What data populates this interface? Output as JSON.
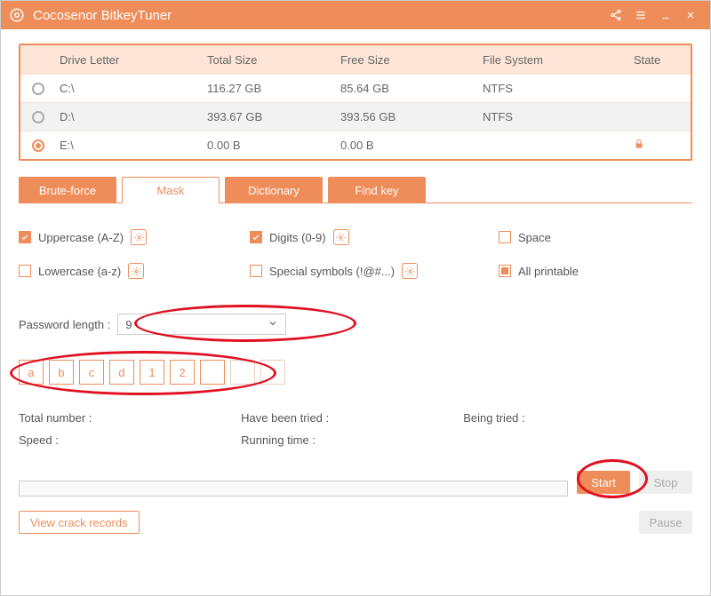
{
  "app": {
    "title": "Cocosenor BitkeyTuner"
  },
  "drives": {
    "headers": {
      "drive": "Drive Letter",
      "total": "Total Size",
      "free": "Free Size",
      "fs": "File System",
      "state": "State"
    },
    "rows": [
      {
        "drive": "C:\\",
        "total": "116.27 GB",
        "free": "85.64 GB",
        "fs": "NTFS",
        "selected": false,
        "locked": false
      },
      {
        "drive": "D:\\",
        "total": "393.67 GB",
        "free": "393.56 GB",
        "fs": "NTFS",
        "selected": false,
        "locked": false
      },
      {
        "drive": "E:\\",
        "total": "0.00 B",
        "free": "0.00 B",
        "fs": "",
        "selected": true,
        "locked": true
      }
    ]
  },
  "tabs": {
    "brute": "Brute-force",
    "mask": "Mask",
    "dict": "Dictionary",
    "findkey": "Find key",
    "active": "mask"
  },
  "options": {
    "uppercase": {
      "label": "Uppercase (A-Z)",
      "checked": true,
      "gear": true
    },
    "digits": {
      "label": "Digits (0-9)",
      "checked": true,
      "gear": true
    },
    "space": {
      "label": "Space",
      "checked": false,
      "gear": false
    },
    "lowercase": {
      "label": "Lowercase (a-z)",
      "checked": false,
      "gear": true
    },
    "symbols": {
      "label": "Special symbols (!@#...)",
      "checked": false,
      "gear": true
    },
    "printable": {
      "label": "All printable",
      "checked": "partial",
      "gear": false
    }
  },
  "password_length": {
    "label": "Password length :",
    "value": "9"
  },
  "mask_chars": [
    "a",
    "b",
    "c",
    "d",
    "1",
    "2",
    "",
    "",
    ""
  ],
  "stats": {
    "total": "Total number :",
    "tried": "Have been tried :",
    "being": "Being tried :",
    "speed": "Speed :",
    "runtime": "Running time :"
  },
  "buttons": {
    "start": "Start",
    "stop": "Stop",
    "pause": "Pause",
    "records": "View crack records"
  },
  "colors": {
    "accent": "#ee8d5a"
  }
}
